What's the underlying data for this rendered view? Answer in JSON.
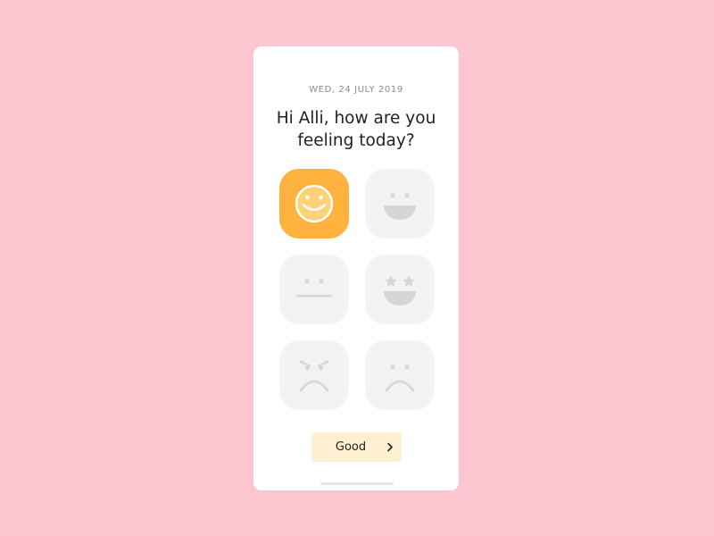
{
  "header": {
    "date": "WED, 24 JULY 2019",
    "greeting_line1": "Hi Alli, how are you",
    "greeting_line2": "feeling today?"
  },
  "moods": [
    {
      "id": "good",
      "icon": "smile-icon",
      "selected": true
    },
    {
      "id": "happy",
      "icon": "big-grin-icon",
      "selected": false
    },
    {
      "id": "neutral",
      "icon": "neutral-face-icon",
      "selected": false
    },
    {
      "id": "excited",
      "icon": "star-eyes-icon",
      "selected": false
    },
    {
      "id": "angry",
      "icon": "angry-face-icon",
      "selected": false
    },
    {
      "id": "sad",
      "icon": "sad-face-icon",
      "selected": false
    }
  ],
  "action": {
    "label": "Good",
    "icon": "chevron-right-icon"
  },
  "colors": {
    "background": "#FBC6CF",
    "card": "#FFFFFF",
    "selected_mood": "#FFB23E",
    "mood_tile": "#F3F3F3",
    "button": "#FFF0D2"
  }
}
